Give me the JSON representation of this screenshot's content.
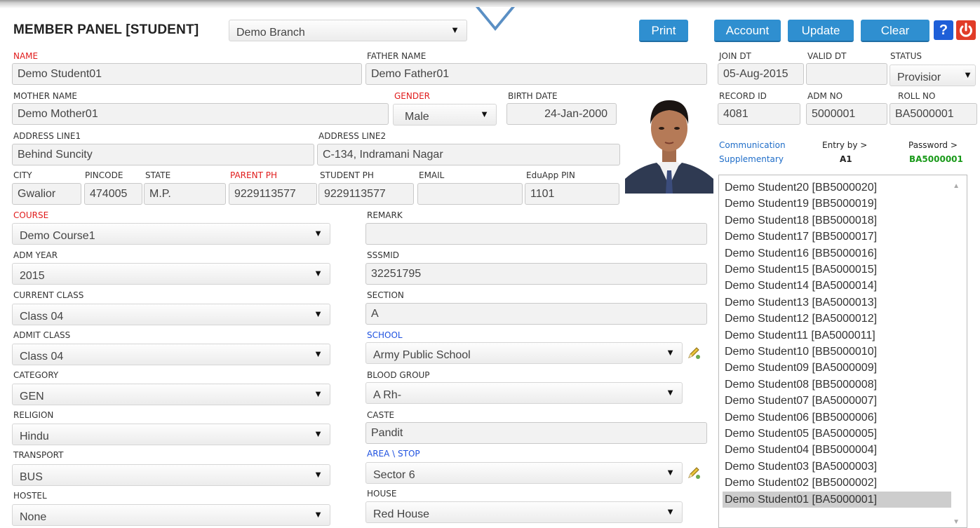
{
  "header": {
    "title": "MEMBER PANEL [STUDENT]",
    "branch": "Demo Branch",
    "buttons": {
      "print": "Print",
      "account": "Account",
      "update": "Update",
      "clear": "Clear"
    },
    "help": "?"
  },
  "form": {
    "name": {
      "label": "NAME",
      "value": "Demo Student01"
    },
    "father_name": {
      "label": "FATHER NAME",
      "value": "Demo Father01"
    },
    "join_dt": {
      "label": "JOIN DT",
      "value": "05-Aug-2015"
    },
    "valid_dt": {
      "label": "VALID DT",
      "value": ""
    },
    "status": {
      "label": "STATUS",
      "value": "Provisior"
    },
    "mother_name": {
      "label": "MOTHER NAME",
      "value": "Demo Mother01"
    },
    "gender": {
      "label": "GENDER",
      "value": "Male"
    },
    "birth_date": {
      "label": "BIRTH DATE",
      "value": "24-Jan-2000"
    },
    "record_id": {
      "label": "RECORD ID",
      "value": "4081"
    },
    "adm_no": {
      "label": "ADM NO",
      "value": "5000001"
    },
    "roll_no": {
      "label": "ROLL NO",
      "value": "BA5000001"
    },
    "address1": {
      "label": "ADDRESS LINE1",
      "value": "Behind Suncity"
    },
    "address2": {
      "label": "ADDRESS LINE2",
      "value": "C-134, Indramani Nagar"
    },
    "city": {
      "label": "CITY",
      "value": "Gwalior"
    },
    "pincode": {
      "label": "PINCODE",
      "value": "474005"
    },
    "state": {
      "label": "STATE",
      "value": "M.P."
    },
    "parent_ph": {
      "label": "PARENT PH",
      "value": "9229113577"
    },
    "student_ph": {
      "label": "STUDENT PH",
      "value": "9229113577"
    },
    "email": {
      "label": "EMAIL",
      "value": ""
    },
    "eduapp_pin": {
      "label": "EduApp PIN",
      "value": "1101"
    },
    "course": {
      "label": "COURSE",
      "value": "Demo Course1"
    },
    "remark": {
      "label": "REMARK",
      "value": ""
    },
    "adm_year": {
      "label": "ADM YEAR",
      "value": "2015"
    },
    "sssmid": {
      "label": "SSSMID",
      "value": "32251795"
    },
    "current_class": {
      "label": "CURRENT CLASS",
      "value": "Class 04"
    },
    "section": {
      "label": "SECTION",
      "value": "A"
    },
    "admit_class": {
      "label": "ADMIT CLASS",
      "value": "Class 04"
    },
    "school": {
      "label": "SCHOOL",
      "value": "Army Public School"
    },
    "category": {
      "label": "CATEGORY",
      "value": "GEN"
    },
    "blood_group": {
      "label": "BLOOD GROUP",
      "value": "A Rh-"
    },
    "religion": {
      "label": "RELIGION",
      "value": "Hindu"
    },
    "caste": {
      "label": "CASTE",
      "value": "Pandit"
    },
    "transport": {
      "label": "TRANSPORT",
      "value": "BUS"
    },
    "area_stop": {
      "label": "AREA \\ STOP",
      "value": "Sector 6"
    },
    "hostel": {
      "label": "HOSTEL",
      "value": "None"
    },
    "house": {
      "label": "HOUSE",
      "value": "Red House"
    }
  },
  "side": {
    "communication": "Communication",
    "supplementary": "Supplementary",
    "entry_by_label": "Entry by >",
    "entry_by_value": "A1",
    "password_label": "Password >",
    "password_value": "BA5000001"
  },
  "students": [
    "Demo Student20 [BB5000020]",
    "Demo Student19 [BB5000019]",
    "Demo Student18 [BB5000018]",
    "Demo Student17 [BB5000017]",
    "Demo Student16 [BB5000016]",
    "Demo Student15 [BA5000015]",
    "Demo Student14 [BA5000014]",
    "Demo Student13 [BA5000013]",
    "Demo Student12 [BA5000012]",
    "Demo Student11 [BA5000011]",
    "Demo Student10 [BB5000010]",
    "Demo Student09 [BA5000009]",
    "Demo Student08 [BB5000008]",
    "Demo Student07 [BA5000007]",
    "Demo Student06 [BB5000006]",
    "Demo Student05 [BA5000005]",
    "Demo Student04 [BB5000004]",
    "Demo Student03 [BA5000003]",
    "Demo Student02 [BB5000002]",
    "Demo Student01 [BA5000001]"
  ],
  "selected_student_index": 19,
  "colors": {
    "button": "#2f8fd0",
    "required_label": "#e01b1b",
    "link_label": "#1f52e0",
    "password": "#1a9a1a"
  }
}
